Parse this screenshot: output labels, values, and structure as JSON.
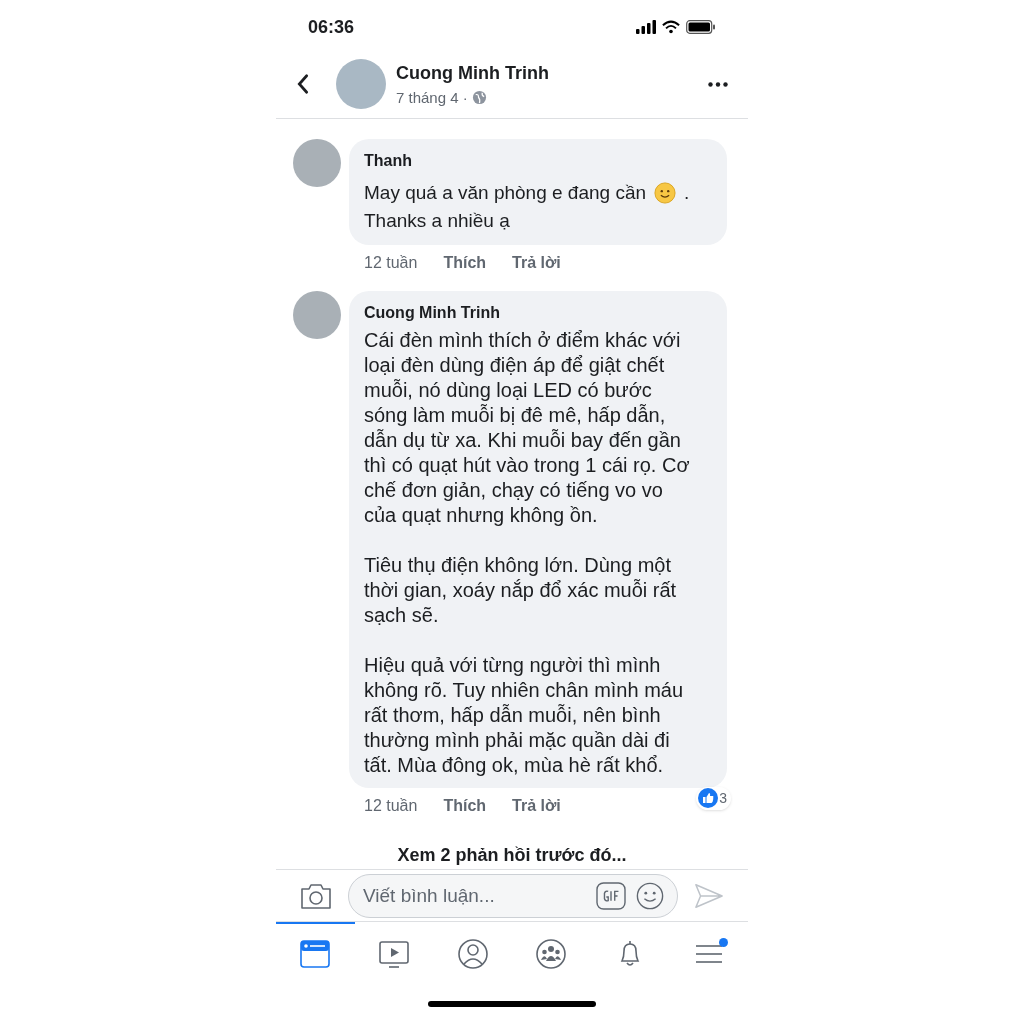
{
  "status_bar": {
    "time": "06:36"
  },
  "post_header": {
    "author": "Cuong Minh Trinh",
    "date": "7 tháng 4 ·"
  },
  "comments": [
    {
      "author": "Thanh",
      "text_before": "May quá a văn phòng e đang cần",
      "text_punct": ".",
      "text_after": "Thanks a nhiều ạ",
      "time": "12 tuần",
      "like": "Thích",
      "reply": "Trả lời"
    },
    {
      "author": "Cuong Minh Trinh",
      "paragraphs": [
        "Cái đèn mình thích ở điểm khác với loại đèn dùng điện áp để giật chết muỗi, nó dùng loại LED có bước sóng làm muỗi bị đê mê, hấp dẫn, dẫn dụ từ xa. Khi muỗi bay đến gần thì có quạt hút vào trong 1 cái rọ. Cơ chế đơn giản, chạy có tiếng vo vo của quạt nhưng không ồn.",
        "Tiêu thụ điện không lớn. Dùng một thời gian, xoáy nắp đổ xác muỗi rất sạch sẽ.",
        "Hiệu quả với từng người thì mình không rõ. Tuy nhiên chân mình máu rất thơm, hấp dẫn muỗi, nên bình thường mình phải mặc quần dài đi tất. Mùa đông ok, mùa hè rất khổ."
      ],
      "time": "12 tuần",
      "like": "Thích",
      "reply": "Trả lời",
      "reaction_count": "3"
    }
  ],
  "view_previous": "Xem 2 phản hồi trước đó...",
  "composer": {
    "placeholder": "Viết bình luận..."
  },
  "nav": [
    {
      "kind": "feed",
      "selected": true,
      "badge": false
    },
    {
      "kind": "video",
      "selected": false,
      "badge": false
    },
    {
      "kind": "profile",
      "selected": false,
      "badge": false
    },
    {
      "kind": "groups",
      "selected": false,
      "badge": false
    },
    {
      "kind": "notifications",
      "selected": false,
      "badge": false
    },
    {
      "kind": "menu",
      "selected": false,
      "badge": true
    }
  ]
}
